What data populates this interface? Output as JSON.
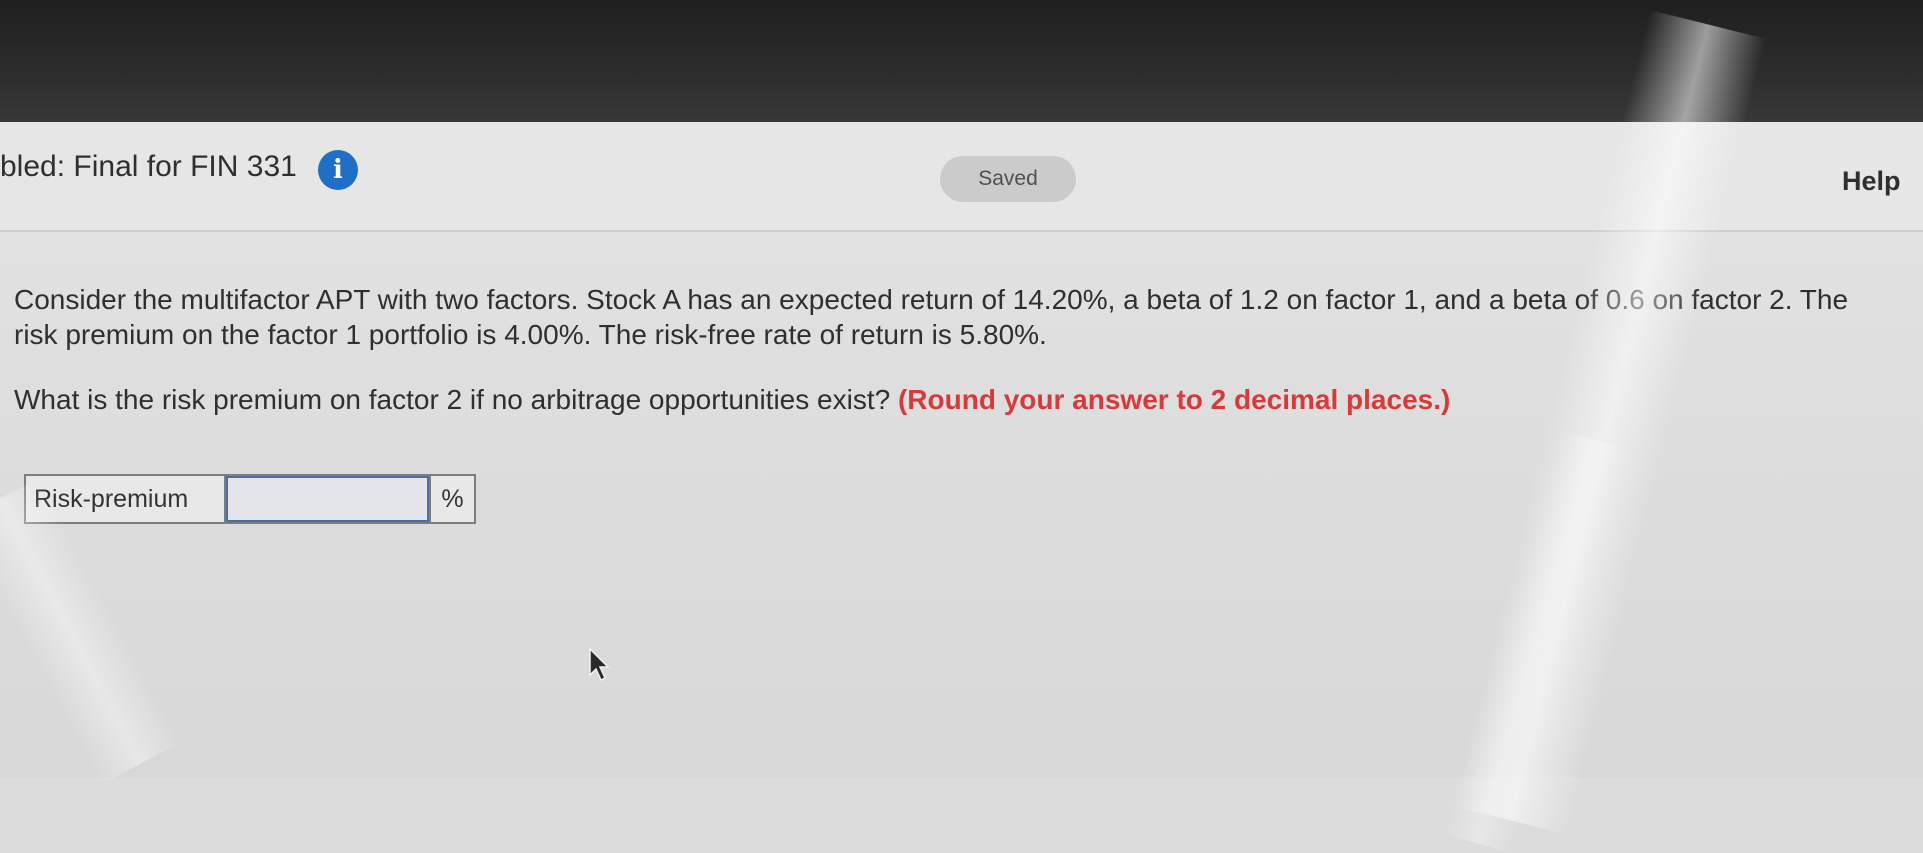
{
  "header": {
    "title": "bled: Final for FIN 331",
    "info_icon": "info-icon",
    "saved_label": "Saved",
    "help_label": "Help"
  },
  "question": {
    "text": "Consider the multifactor APT with two factors. Stock A has an expected return of 14.20%, a beta of 1.2 on factor 1, and a beta of 0.6 on factor 2. The risk premium on the factor 1 portfolio is 4.00%. The risk-free rate of return is 5.80%.",
    "prompt": "What is the risk premium on factor 2 if no arbitrage opportunities exist?",
    "instruction": "(Round your answer to 2 decimal places.)"
  },
  "answer": {
    "label": "Risk-premium",
    "value": "",
    "unit": "%"
  },
  "colors": {
    "info_icon": "#1f6fc6",
    "instruction": "#d63a3a",
    "input_border": "#4a6fa5"
  }
}
